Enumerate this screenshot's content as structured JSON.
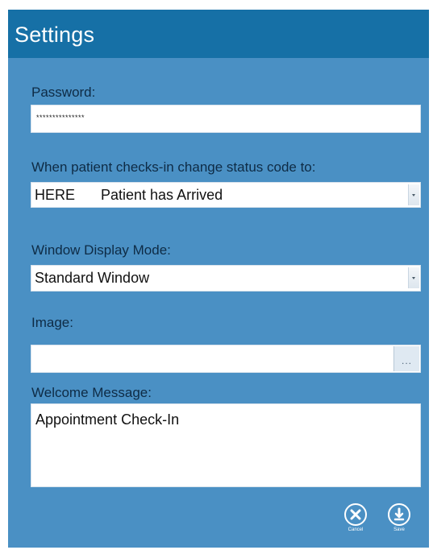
{
  "title": "Settings",
  "password": {
    "label": "Password:",
    "masked_value": "***************"
  },
  "checkin_status": {
    "label": "When patient checks-in change status code to:",
    "code": "HERE",
    "description": "Patient has Arrived"
  },
  "display_mode": {
    "label": "Window Display Mode:",
    "value": "Standard Window"
  },
  "image": {
    "label": "Image:",
    "value": "",
    "browse_label": "..."
  },
  "welcome": {
    "label": "Welcome Message:",
    "value": "Appointment Check-In"
  },
  "actions": {
    "cancel_label": "Cancel",
    "save_label": "Save"
  },
  "icons": [
    "chevron-down-icon",
    "close-circle-icon",
    "download-circle-icon"
  ],
  "colors": {
    "titlebar": "#1670a6",
    "panel": "#4a90c4",
    "label_text": "#0e2b45"
  }
}
